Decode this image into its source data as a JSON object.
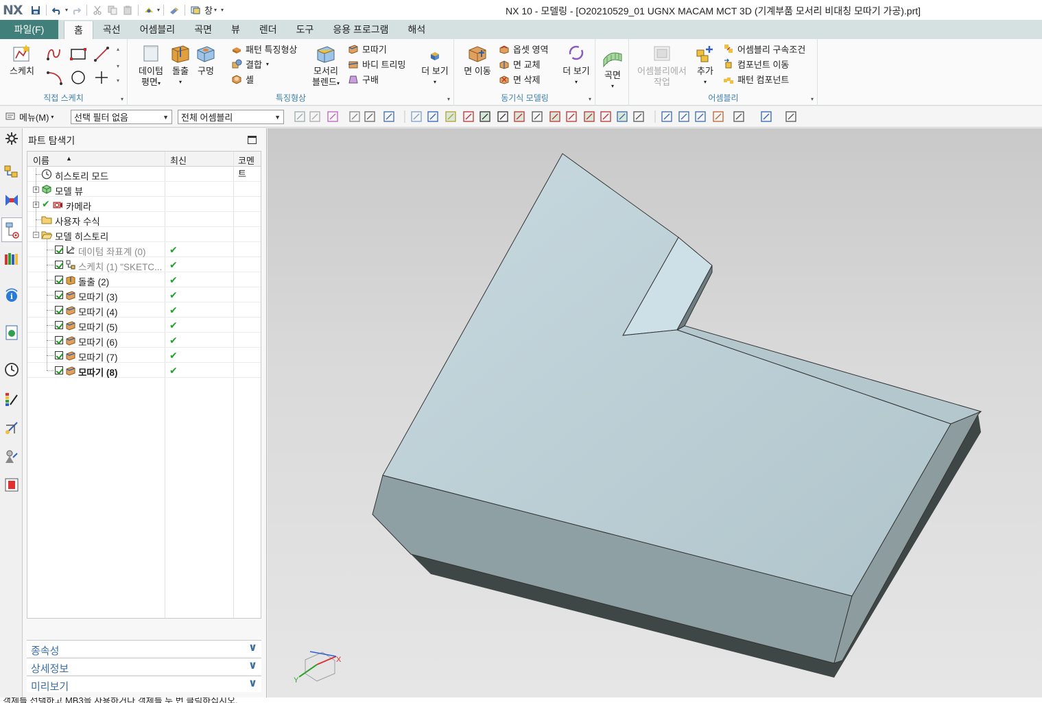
{
  "titlebar": {
    "logo": "NX",
    "window_menu": "창",
    "title": "NX 10 - 모델링 - [O20210529_01 UGNX MACAM MCT 3D (기계부품 모서리 비대칭 모따기 가공).prt]"
  },
  "tabs": {
    "file": "파일(F)",
    "items": [
      "홈",
      "곡선",
      "어셈블리",
      "곡면",
      "뷰",
      "렌더",
      "도구",
      "응용 프로그램",
      "해석"
    ],
    "active": "홈"
  },
  "ribbon": {
    "sketch": "스케치",
    "direct_sketch": "직접 스케치",
    "datum_plane": "데이텀\n평면",
    "datum_plane_l1": "데이텀",
    "datum_plane_l2": "평면",
    "extrude": "돌출",
    "hole": "구멍",
    "pattern_feature": "패턴 특징형상",
    "unite": "결합",
    "shell": "셸",
    "edge_blend_l1": "모서리",
    "edge_blend_l2": "블렌드",
    "chamfer": "모따기",
    "trim_body": "바디 트리밍",
    "draft": "구배",
    "more1": "더 보기",
    "features_label": "특징형상",
    "move_face": "면 이동",
    "offset_region": "옵셋 영역",
    "replace_face": "면 교체",
    "delete_face": "면 삭제",
    "more2": "더 보기",
    "sync_label": "동기식 모델링",
    "surface": "곡면",
    "assembly_work_l1": "어셈블리에서",
    "assembly_work_l2": "작업",
    "add": "추가",
    "assembly_constraints": "어셈블리 구속조건",
    "move_component": "컴포넌트 이동",
    "pattern_component": "패턴 컴포넌트",
    "assembly_label": "어셈블리"
  },
  "cmdbar": {
    "menu": "메뉴(M)",
    "selection_filter": "선택 필터 없음",
    "scope": "전체 어셈블리"
  },
  "navigator": {
    "title": "파트 탐색기",
    "columns": [
      "이름",
      "최신",
      "코멘트"
    ],
    "rows": [
      {
        "label": "히스토리 모드",
        "style": "normal"
      },
      {
        "label": "모델 뷰",
        "style": "normal"
      },
      {
        "label": "카메라",
        "style": "normal"
      },
      {
        "label": "사용자 수식",
        "style": "normal"
      },
      {
        "label": "모델 히스토리",
        "style": "normal"
      },
      {
        "label": "데이텀 좌표계 (0)",
        "style": "gray"
      },
      {
        "label": "스케치 (1) \"SKETC...",
        "style": "gray"
      },
      {
        "label": "돌출 (2)",
        "style": "normal"
      },
      {
        "label": "모따기 (3)",
        "style": "normal"
      },
      {
        "label": "모따기 (4)",
        "style": "normal"
      },
      {
        "label": "모따기 (5)",
        "style": "normal"
      },
      {
        "label": "모따기 (6)",
        "style": "normal"
      },
      {
        "label": "모따기 (7)",
        "style": "normal"
      },
      {
        "label": "모따기 (8)",
        "style": "bold"
      }
    ],
    "panels": [
      "종속성",
      "상세정보",
      "미리보기"
    ]
  },
  "viewport": {
    "triad_x": "X",
    "triad_y": "Y"
  },
  "status": {
    "text": "객체를 선택하고 MB3을 사용하거나 객체를 두 번 클릭하십시오."
  },
  "colors": {
    "file_tab": "#41807a",
    "tab_bar": "#d5e0e0",
    "group_label": "#3c7fae",
    "check_green": "#22a22a"
  }
}
